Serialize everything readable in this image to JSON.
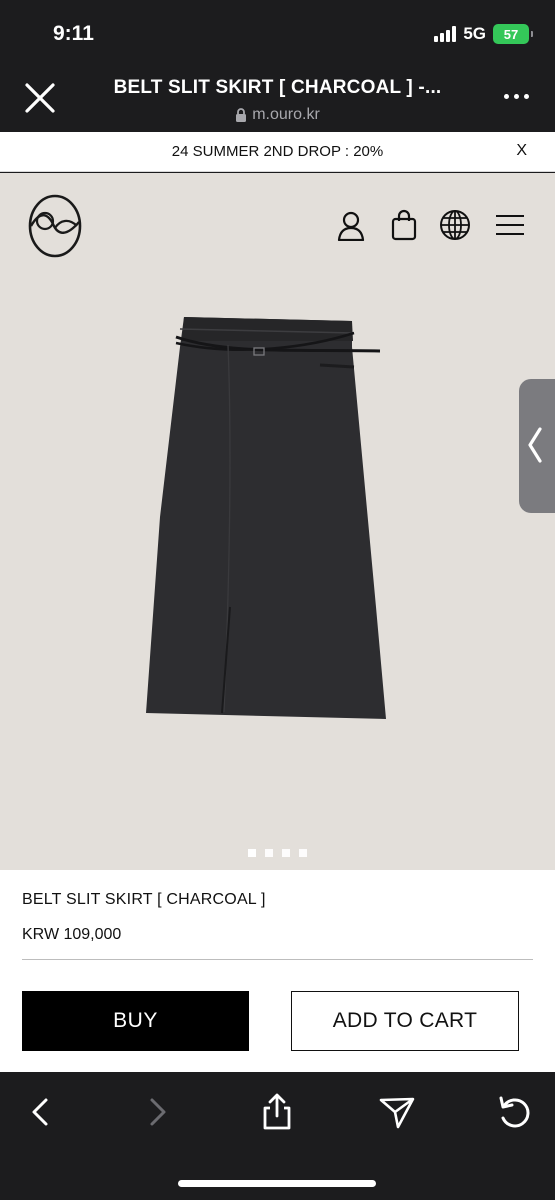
{
  "status_bar": {
    "time": "9:11",
    "network": "5G",
    "battery": "57"
  },
  "browser": {
    "title": "BELT SLIT SKIRT [ CHARCOAL ] -...",
    "url": "m.ouro.kr"
  },
  "promo": {
    "text": "24 SUMMER 2ND DROP : 20%",
    "close": "X"
  },
  "header": {
    "icons": [
      "user-icon",
      "shopping-bag-icon",
      "globe-icon",
      "menu-icon"
    ]
  },
  "gallery": {
    "image_count": 4,
    "active_index": 0
  },
  "product": {
    "name": "BELT SLIT SKIRT [ CHARCOAL ]",
    "price": "KRW 109,000",
    "buy_label": "BUY",
    "cart_label": "ADD TO CART"
  },
  "colors": {
    "browser_chrome": "#1c1c1e",
    "hero_bg": "#e3dfda",
    "skirt": "#2d2d30",
    "battery": "#34c759",
    "buy_button": "#000000"
  }
}
